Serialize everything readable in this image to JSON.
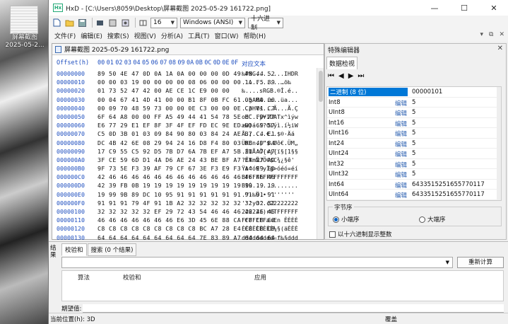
{
  "desktop": {
    "icon_label": "屏幕截图\n2025-05-2..."
  },
  "window": {
    "title": "HxD - [C:\\Users\\8059\\Desktop\\屏幕截图 2025-05-29 161722.png]",
    "logo_text": "Hx",
    "controls": {
      "min": "—",
      "max": "☐",
      "close": "✕"
    }
  },
  "toolbar": {
    "columns_value": "16",
    "charset_value": "Windows (ANSI)",
    "offset_base_value": "十六进制"
  },
  "menu": {
    "items": [
      "文件(F)",
      "编辑(E)",
      "搜索(S)",
      "视图(V)",
      "分析(A)",
      "工具(T)",
      "窗口(W)",
      "帮助(H)"
    ],
    "right_icons": [
      "▾",
      "⧉",
      "✕"
    ]
  },
  "editor": {
    "tab_label": "屏幕截图 2025-05-29 161722.png",
    "header": {
      "offset": "Offset(h)",
      "columns": [
        "00",
        "01",
        "02",
        "03",
        "04",
        "05",
        "06",
        "07",
        "08",
        "09",
        "0A",
        "0B",
        "0C",
        "0D",
        "0E",
        "0F"
      ],
      "text": "对应文本"
    },
    "rows": [
      {
        "off": "00000000",
        "hex": "89 50 4E 47 0D 0A 1A 0A 00 00 00 0D 49 48 44 52",
        "txt": "‰PNG........IHDR"
      },
      {
        "off": "00000010",
        "hex": "00 00 03 19 00 00 00 00 08 06 00 00 00 1A F5 89",
        "txt": "...........…õ‰"
      },
      {
        "off": "00000020",
        "hex": "01 73 52 47 42 00 AE CE 1C E9 00 00",
        "txt": "‰....sRGB.®Î.é.."
      },
      {
        "off": "00000030",
        "hex": "00 04 67 41 4D 41 00 00 B1 8F 0B FC 61 05 00 00",
        "txt": "..gAMA..±..üa..."
      },
      {
        "off": "00000040",
        "hex": "00 09 70 48 59 73 00 00 0E C3 00 00 0E C3 01 C7",
        "txt": "..pHYs...Ã...Ã.Ç"
      },
      {
        "off": "00000050",
        "hex": "6F 64 A8 00 00 FF A5 49 44 41 54 78 5E EC FD 77",
        "txt": "od¨..ÿ¥IDATx^ìýw"
      },
      {
        "off": "00000060",
        "hex": "E6 77 29 E1 EF 8F 3F 4F EF FD EC 9E ED BD 69 57",
        "txt": "æw)á.ï?Oïýì.í½iW"
      },
      {
        "off": "00000070",
        "hex": "C5 0D 3B 01 03 09 84 90 80 03 84 24 AE B7 C4 E1",
        "txt": "Å.;....€..$®·Äá"
      },
      {
        "off": "00000080",
        "hex": "DC 4B 42 6E 08 29 94 24 16 D8 F4 80 03 DC 4D 84",
        "txt": "ÜKBn.)”$.Øô€.ÜM„"
      },
      {
        "off": "00000090",
        "hex": "17 C9 55 C5 92 D5 7B D7 6A 7B EF A7 5B 31 A7 A7",
        "txt": ".ÉUÅ’Õ{×j{ï§[1§§"
      },
      {
        "off": "000000A0",
        "hex": "3F CE 59 6D D1 4A D6 AE 24 43 BE BF A7 EA 27 AD",
        "txt": "?ÎYmÑJÖ®$C¾¿§ê'­"
      },
      {
        "off": "000000B0",
        "hex": "9F 73 5E F3 39 AF 79 CF 67 3E F3 E9 F3 A4 E9 ED",
        "txt": "Ÿs^ó9¯yÏg>óéó¤éí"
      },
      {
        "off": "000000C0",
        "hex": "42 46 46 46 46 46 46 46 46 46 46 46 46 46 46 46",
        "txt": "BFFFFFFFFFFFFFFF"
      },
      {
        "off": "000000D0",
        "hex": "42 39 FB 0B 19 19 19 19 19 19 19 19 19 19 19 19",
        "txt": "B9û............."
      },
      {
        "off": "000000E0",
        "hex": "19 99 9B 89 DC 10 95 91 91 91 91 91 91 91 91 91",
        "txt": ".™›‰Ü.•''''''''"
      },
      {
        "off": "000000F0",
        "hex": "91 91 91 79 4F 91 1B A2 32 32 32 32 32 32 32 32",
        "txt": "'''yO'.¢22222222"
      },
      {
        "off": "00000100",
        "hex": "32 32 32 32 32 EF 29 72 43 54 46 46 46 46 46 46",
        "txt": "22222ï)rCTFFFFFF"
      },
      {
        "off": "00000110",
        "hex": "46 46 46 46 46 46 46 E6 3D 45 6E 88 CA C8 C8 C8",
        "txt": "FFFFFFFæ=En ÊÈÈÈ"
      },
      {
        "off": "00000120",
        "hex": "C8 C8 C8 C8 C8 C8 C8 C8 C8 BC A7 28 E4 C8 C8 C8",
        "txt": "ÈÈÈÈÈÈÈÈÈ¼§(äÈÈÈ"
      },
      {
        "off": "00000130",
        "hex": "64 64 64 64 64 64 64 64 64 7E 83 89 A7 64 64 64",
        "txt": "ddddddddd~ƒ‰§ddd"
      },
      {
        "off": "00000140",
        "hex": "47 24 7C 2B 2D FB DF 6F A1 58 A3 C0 8C 3D 7B 88",
        "txt": "G$|+-ûßo¡X£ÀŒ={ˆ"
      }
    ]
  },
  "inspector": {
    "title": "特殊编辑器",
    "close": "✕",
    "tab": "数据检视",
    "nav": [
      "⏮",
      "◀",
      "▶",
      "⏭"
    ],
    "rows": [
      {
        "name": "二进制 (8 位)",
        "edit": "",
        "value": "00000101"
      },
      {
        "name": "Int8",
        "edit": "编辑",
        "value": "5"
      },
      {
        "name": "UInt8",
        "edit": "编辑",
        "value": "5"
      },
      {
        "name": "Int16",
        "edit": "编辑",
        "value": "5"
      },
      {
        "name": "UInt16",
        "edit": "编辑",
        "value": "5"
      },
      {
        "name": "Int24",
        "edit": "编辑",
        "value": "5"
      },
      {
        "name": "UInt24",
        "edit": "编辑",
        "value": "5"
      },
      {
        "name": "Int32",
        "edit": "编辑",
        "value": "5"
      },
      {
        "name": "UInt32",
        "edit": "编辑",
        "value": "5"
      },
      {
        "name": "Int64",
        "edit": "编辑",
        "value": "6433515251655770117"
      },
      {
        "name": "UInt64",
        "edit": "编辑",
        "value": "6433515251655770117"
      }
    ],
    "byte_order_title": "字节序",
    "little_endian": "小端序",
    "big_endian": "大端序",
    "hex_checkbox": "以十六进制显示整数"
  },
  "results": {
    "side_label": "结果",
    "tabs": [
      "校验和",
      "搜索 (0 个结果)"
    ],
    "recalc": "重新计算",
    "headers": [
      "算法",
      "校验和",
      "应用"
    ],
    "expected_label": "期望值:"
  },
  "status": {
    "position": "当前位置(h): 3D",
    "mode": "覆盖"
  }
}
